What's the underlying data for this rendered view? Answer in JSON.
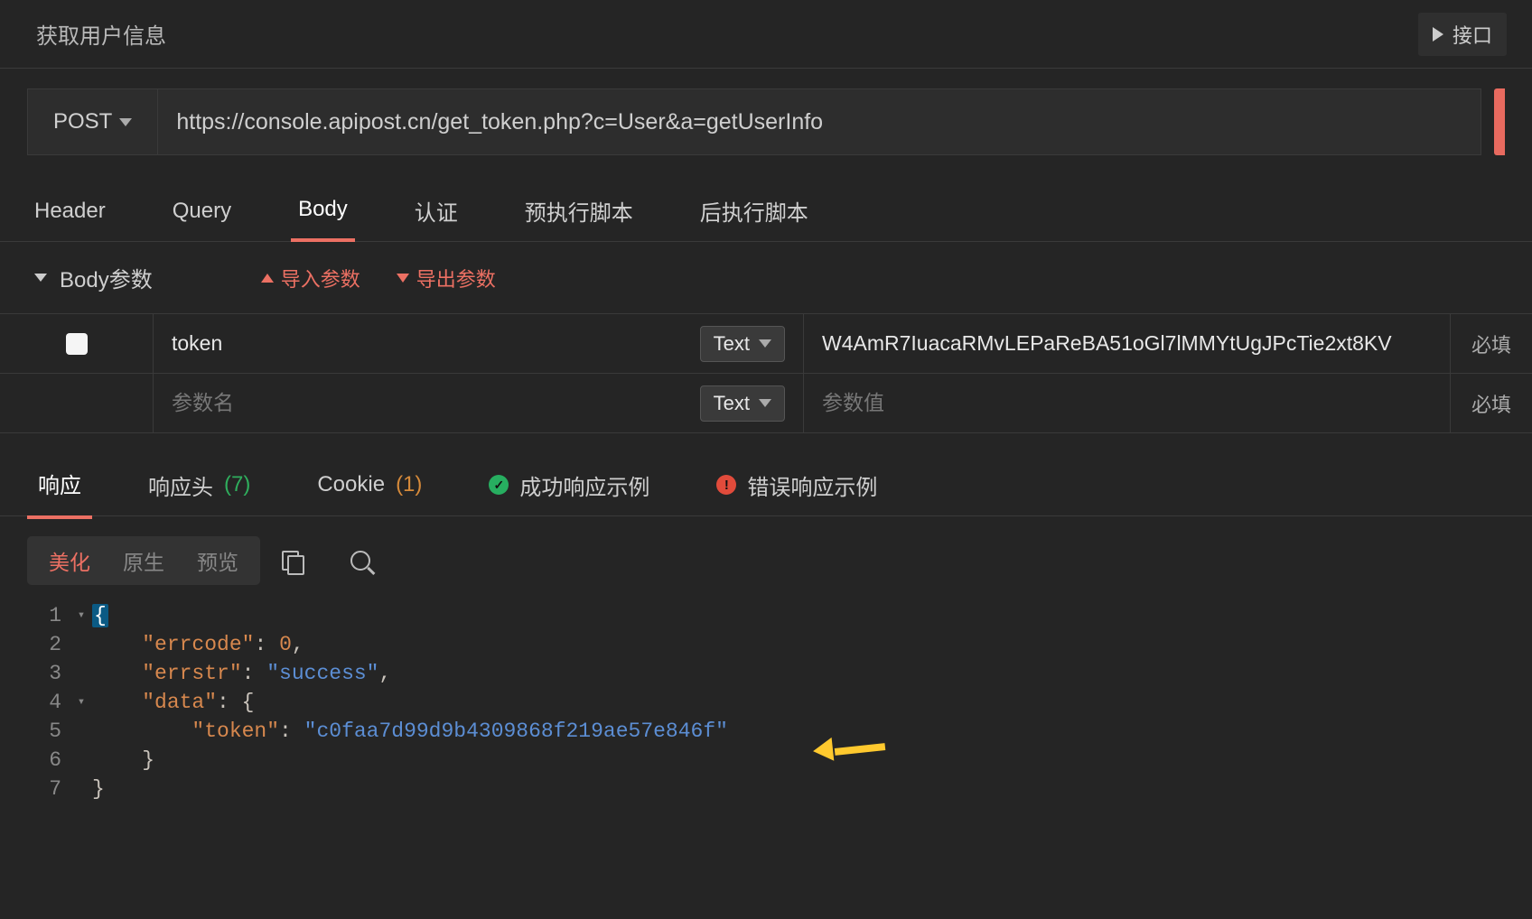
{
  "header": {
    "title": "获取用户信息",
    "play_label": "接口"
  },
  "request": {
    "method": "POST",
    "url": "https://console.apipost.cn/get_token.php?c=User&a=getUserInfo"
  },
  "request_tabs": {
    "header": "Header",
    "query": "Query",
    "body": "Body",
    "auth": "认证",
    "pre": "预执行脚本",
    "post": "后执行脚本",
    "active": "body"
  },
  "body_section": {
    "title": "Body参数",
    "import": "导入参数",
    "export": "导出参数"
  },
  "params": {
    "type_label": "Text",
    "required_label": "必填",
    "name_placeholder": "参数名",
    "value_placeholder": "参数值",
    "rows": [
      {
        "checked": false,
        "key": "token",
        "type": "Text",
        "value": "W4AmR7IuacaRMvLEPaReBA51oGl7lMMYtUgJPcTie2xt8KV"
      },
      {
        "checked": false,
        "key": "",
        "type": "Text",
        "value": ""
      }
    ]
  },
  "response_tabs": {
    "response": "响应",
    "headers": "响应头",
    "headers_count": "(7)",
    "cookie": "Cookie",
    "cookie_count": "(1)",
    "success": "成功响应示例",
    "error": "错误响应示例"
  },
  "response_toolbar": {
    "pretty": "美化",
    "raw": "原生",
    "preview": "预览"
  },
  "response_body": {
    "lines": [
      {
        "n": 1,
        "fold": "▾",
        "indent": 0,
        "tokens": [
          {
            "t": "hl",
            "v": "{"
          }
        ]
      },
      {
        "n": 2,
        "fold": "",
        "indent": 1,
        "tokens": [
          {
            "t": "k",
            "v": "\"errcode\""
          },
          {
            "t": "p",
            "v": ": "
          },
          {
            "t": "n",
            "v": "0"
          },
          {
            "t": "p",
            "v": ","
          }
        ]
      },
      {
        "n": 3,
        "fold": "",
        "indent": 1,
        "tokens": [
          {
            "t": "k",
            "v": "\"errstr\""
          },
          {
            "t": "p",
            "v": ": "
          },
          {
            "t": "s",
            "v": "\"success\""
          },
          {
            "t": "p",
            "v": ","
          }
        ]
      },
      {
        "n": 4,
        "fold": "▾",
        "indent": 1,
        "tokens": [
          {
            "t": "k",
            "v": "\"data\""
          },
          {
            "t": "p",
            "v": ": {"
          }
        ]
      },
      {
        "n": 5,
        "fold": "",
        "indent": 2,
        "tokens": [
          {
            "t": "k",
            "v": "\"token\""
          },
          {
            "t": "p",
            "v": ": "
          },
          {
            "t": "s",
            "v": "\"c0faa7d99d9b4309868f219ae57e846f\""
          }
        ]
      },
      {
        "n": 6,
        "fold": "",
        "indent": 1,
        "tokens": [
          {
            "t": "p",
            "v": "}"
          }
        ]
      },
      {
        "n": 7,
        "fold": "",
        "indent": 0,
        "tokens": [
          {
            "t": "p",
            "v": "}"
          }
        ]
      }
    ]
  }
}
